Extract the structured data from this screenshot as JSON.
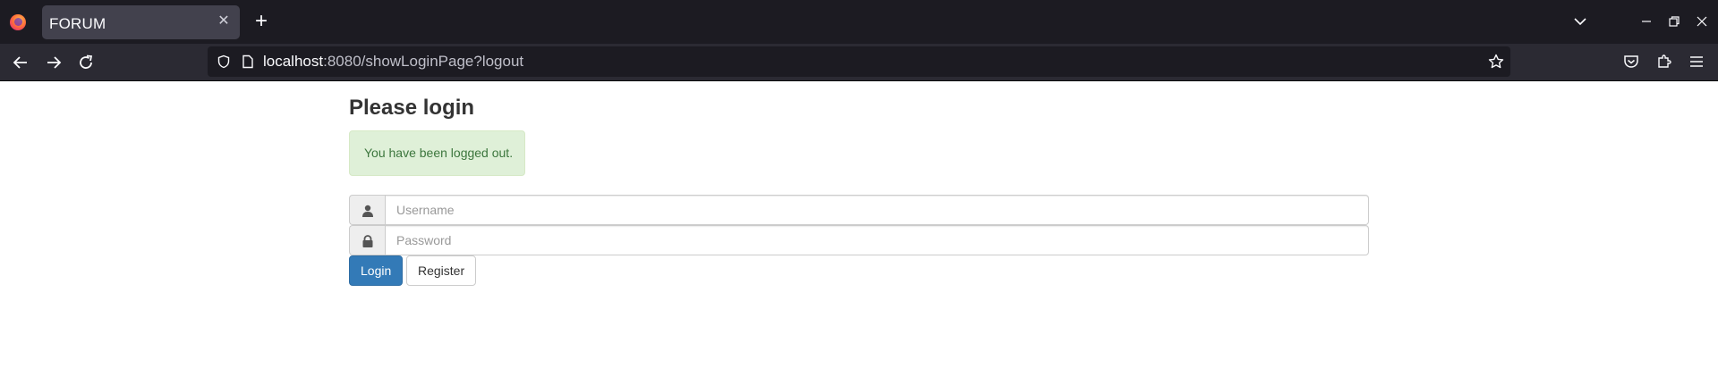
{
  "browser": {
    "tab_title": "FORUM",
    "url_host": "localhost",
    "url_rest": ":8080/showLoginPage?logout"
  },
  "page": {
    "title": "Please login",
    "alert": "You have been logged out.",
    "username_placeholder": "Username",
    "password_placeholder": "Password",
    "login_label": "Login",
    "register_label": "Register"
  },
  "colors": {
    "primary": "#337ab7",
    "success_bg": "#dff0d8",
    "success_text": "#3c763d"
  }
}
